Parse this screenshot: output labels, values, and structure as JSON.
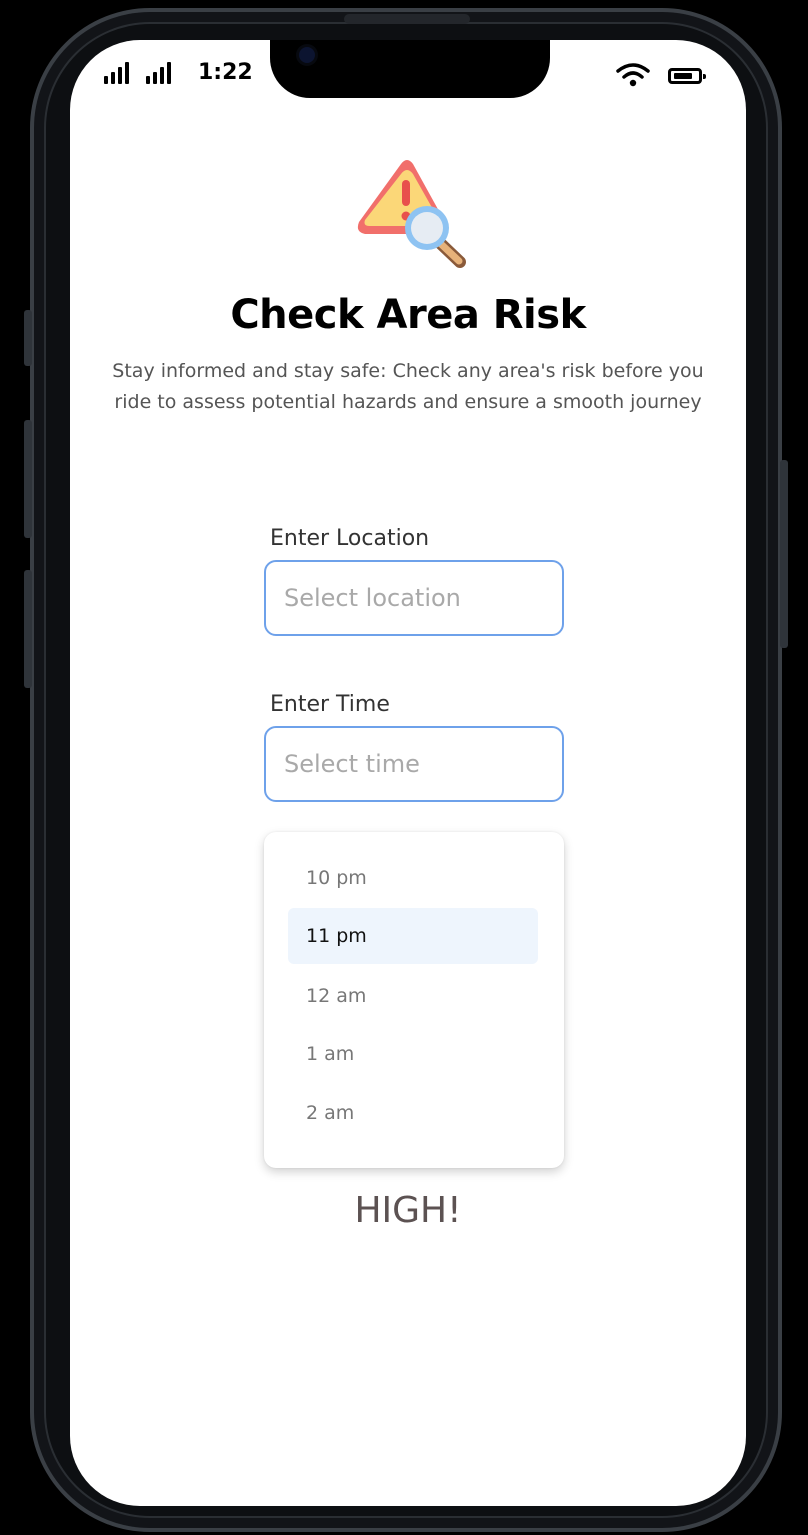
{
  "status_bar": {
    "time": "1:22",
    "icons": [
      "signal-icon",
      "signal-icon",
      "wifi-icon",
      "battery-icon"
    ]
  },
  "hero": {
    "icon": "warning-search-icon",
    "title": "Check Area Risk",
    "subtitle": "Stay informed and stay safe: Check any area's risk before you ride to assess potential hazards and ensure a smooth journey"
  },
  "location_field": {
    "label": "Enter Location",
    "placeholder": "Select location",
    "value": ""
  },
  "time_field": {
    "label": "Enter Time",
    "placeholder": "Select time",
    "value": ""
  },
  "time_options": [
    "10 pm",
    "11 pm",
    "12 am",
    "1 am",
    "2 am"
  ],
  "selected_option": "11 pm",
  "risk_result": "HIGH!",
  "colors": {
    "accent_border": "#6ea1ea",
    "selected_bg": "#eef5fd",
    "warning_red": "#f16f6b",
    "warning_yellow": "#fbd778"
  }
}
